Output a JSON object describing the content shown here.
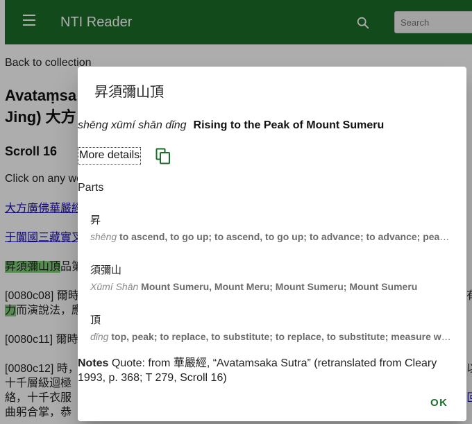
{
  "app": {
    "title": "NTI Reader",
    "search_placeholder": "Search",
    "brand_color": "#1b6e29",
    "menu_icon": "menu-icon",
    "search_icon": "search-icon"
  },
  "page": {
    "back_link": "Back to collection",
    "doc_title": "Avataṃsa\nJing) 大方",
    "scroll_heading": "Scroll 16",
    "click_hint": "Click on any wo",
    "link1": "大方廣佛華嚴經",
    "link2": "于闐國三藏實叉",
    "line_title_highlight": "昇須彌山頂",
    "line_title_rest": "品第",
    "line1_ref": "[0080c08]",
    "line1_text": " 爾時",
    "line1_right": "有",
    "line2_highlight": "力",
    "line2_text": "而演說法，應",
    "line3_ref": "[0080c11]",
    "line3_text": " 爾時",
    "line4_ref": "[0080c12]",
    "line4_text": " 時，",
    "line4_right": "以",
    "line5_text": "十千層級迴極",
    "line6_text": "絡，十千衣服",
    "line6_right": "叵",
    "line7_text": "曲躬合掌，恭"
  },
  "dialog": {
    "title": "昇須彌山頂",
    "pinyin": "shēng xūmí shān dǐng",
    "english": "Rising to the Peak of Mount Sumeru",
    "more_details": "More details",
    "copy_icon": "copy-icon",
    "parts_label": "Parts",
    "parts": [
      {
        "chinese": "昇",
        "pinyin": "shēng",
        "english": "to ascend, to go up; to ascend, to go up; to advance; to advance; peace; to rise; ascend"
      },
      {
        "chinese": "須彌山",
        "pinyin": "Xūmí Shān",
        "english": "Mount Sumeru, Mount Meru; Mount Sumeru; Mount Sumeru"
      },
      {
        "chinese": "頂",
        "pinyin": "dǐng",
        "english": "top, peak; to replace, to substitute; to replace, to substitute; measure word for headwear"
      }
    ],
    "notes_label": "Notes",
    "notes_text": " Quote: from 華嚴經, “Avatamsaka Sutra” (retranslated from Cleary 1993, p. 368; T 279, Scroll 16)",
    "ok_label": "OK"
  }
}
